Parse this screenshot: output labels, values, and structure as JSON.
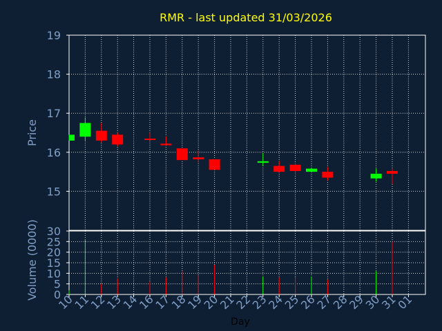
{
  "chart_data": {
    "type": "candlestick",
    "title": "RMR - last updated 31/03/2026",
    "colors": {
      "background": "#0f1f33",
      "title": "#ffff00",
      "axis_text": "#7f9fc7",
      "frame": "#ffffff",
      "grid": "#ffffff",
      "up": "#00ff00",
      "down": "#ff0000",
      "xlabel": "#000000"
    },
    "price_panel": {
      "ylabel": "Price",
      "ylim": [
        14,
        19
      ],
      "yticks": [
        15,
        16,
        17,
        18,
        19
      ],
      "grid": true
    },
    "volume_panel": {
      "ylabel": "Volume (0000)",
      "ylim": [
        0,
        30
      ],
      "yticks": [
        0,
        5,
        10,
        15,
        20,
        25,
        30
      ],
      "grid": true
    },
    "xlabel": "Day",
    "x_ticks": [
      "10",
      "11",
      "12",
      "13",
      "14",
      "16",
      "17",
      "18",
      "19",
      "20",
      "21",
      "22",
      "23",
      "24",
      "25",
      "26",
      "27",
      "28",
      "29",
      "30",
      "31",
      "01"
    ],
    "candles": [
      {
        "day": "10",
        "open": 16.3,
        "high": 16.45,
        "low": 16.3,
        "close": 16.45,
        "volume": 2.0
      },
      {
        "day": "11",
        "open": 16.4,
        "high": 16.9,
        "low": 16.3,
        "close": 16.75,
        "volume": 26.0
      },
      {
        "day": "12",
        "open": 16.55,
        "high": 16.75,
        "low": 16.25,
        "close": 16.3,
        "volume": 5.0
      },
      {
        "day": "13",
        "open": 16.45,
        "high": 16.5,
        "low": 16.15,
        "close": 16.2,
        "volume": 7.5
      },
      {
        "day": "16",
        "open": 16.35,
        "high": 16.5,
        "low": 16.3,
        "close": 16.32,
        "volume": 6.0
      },
      {
        "day": "17",
        "open": 16.22,
        "high": 16.4,
        "low": 16.18,
        "close": 16.18,
        "volume": 8.0
      },
      {
        "day": "18",
        "open": 16.1,
        "high": 16.1,
        "low": 15.8,
        "close": 15.8,
        "volume": 11.0
      },
      {
        "day": "19",
        "open": 15.87,
        "high": 16.05,
        "low": 15.73,
        "close": 15.82,
        "volume": 9.0
      },
      {
        "day": "20",
        "open": 15.82,
        "high": 15.82,
        "low": 15.55,
        "close": 15.55,
        "volume": 14.0
      },
      {
        "day": "23",
        "open": 15.73,
        "high": 15.98,
        "low": 15.65,
        "close": 15.77,
        "volume": 8.5
      },
      {
        "day": "24",
        "open": 15.65,
        "high": 15.78,
        "low": 15.48,
        "close": 15.5,
        "volume": 8.0
      },
      {
        "day": "25",
        "open": 15.68,
        "high": 15.72,
        "low": 15.43,
        "close": 15.52,
        "volume": 8.0
      },
      {
        "day": "26",
        "open": 15.5,
        "high": 15.6,
        "low": 15.5,
        "close": 15.58,
        "volume": 8.5
      },
      {
        "day": "27",
        "open": 15.5,
        "high": 15.62,
        "low": 15.28,
        "close": 15.35,
        "volume": 7.0
      },
      {
        "day": "30",
        "open": 15.33,
        "high": 15.58,
        "low": 15.25,
        "close": 15.45,
        "volume": 11.0
      },
      {
        "day": "31",
        "open": 15.52,
        "high": 15.58,
        "low": 15.18,
        "close": 15.45,
        "volume": 25.0
      }
    ]
  }
}
